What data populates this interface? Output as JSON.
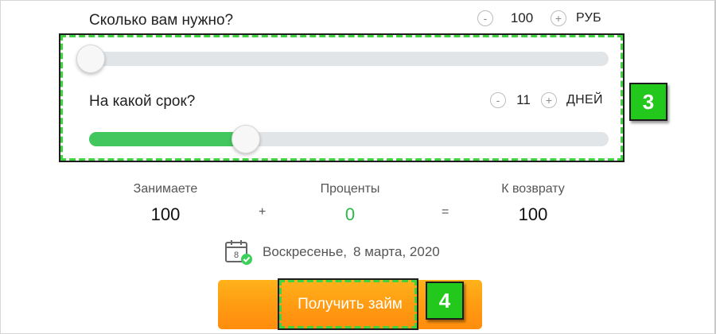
{
  "amount": {
    "label": "Сколько вам нужно?",
    "minus": "-",
    "plus": "+",
    "value": "100",
    "unit": "РУБ",
    "slider_fraction": 0.0
  },
  "term": {
    "label": "На какой срок?",
    "minus": "-",
    "plus": "+",
    "value": "11",
    "unit": "ДНЕЙ",
    "slider_fraction": 0.29
  },
  "summary": {
    "borrow_label": "Занимаете",
    "borrow_value": "100",
    "plus_sign": "+",
    "interest_label": "Проценты",
    "interest_value": "0",
    "equals_sign": "=",
    "return_label": "К возврату",
    "return_value": "100"
  },
  "due_date": {
    "calendar_day": "8",
    "weekday": "Воскресенье,",
    "date": "8 марта, 2020"
  },
  "submit": {
    "label": "Получить займ"
  },
  "annotations": {
    "badge_sliders": "3",
    "badge_button": "4"
  },
  "colors": {
    "accent_green": "#41c75d",
    "interest_green": "#2db84a",
    "cta_orange": "#ff9a12",
    "annotation_green": "#22c81c"
  }
}
